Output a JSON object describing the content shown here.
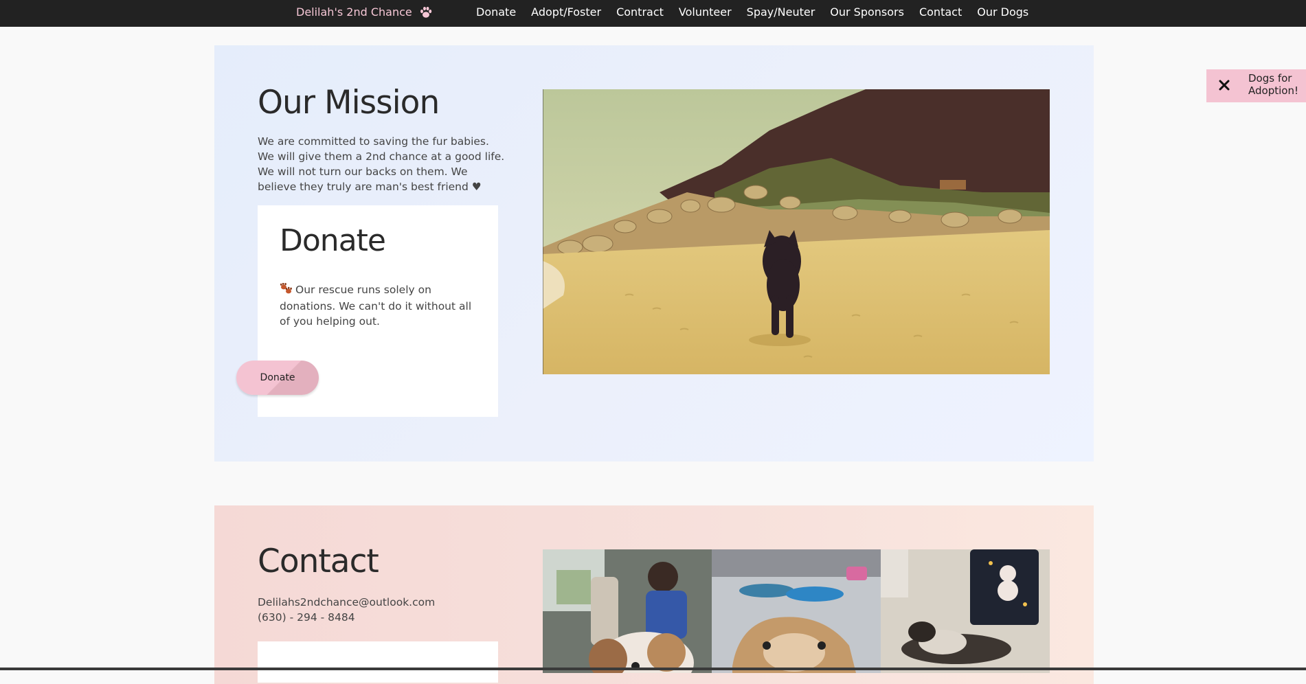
{
  "brand": {
    "name": "Delilah's 2nd Chance",
    "icon": "paw-icon"
  },
  "nav": {
    "items": [
      "Donate",
      "Adopt/Foster",
      "Contract",
      "Volunteer",
      "Spay/Neuter",
      "Our Sponsors",
      "Contact",
      "Our Dogs"
    ]
  },
  "mission": {
    "title": "Our Mission",
    "text": "We are committed to saving the fur babies. We will give them a 2nd chance at a good life. We will not turn our backs on them. We believe they truly are man's best friend ♥"
  },
  "donate": {
    "title": "Donate",
    "text": "Our rescue runs solely on donations. We can't do it without all of you helping out.",
    "button_label": "Donate"
  },
  "contact": {
    "title": "Contact",
    "email": "Delilahs2ndchance@outlook.com",
    "phone": "(630) - 294 - 8484"
  },
  "toast": {
    "message": "Dogs for Adoption!",
    "close_icon": "close-icon"
  },
  "colors": {
    "topbar": "#222222",
    "brand": "#f6c7d6",
    "pink_accent": "#f4c3d2",
    "mission_bg": "#e9eefb",
    "contact_bg": "#f6dcd8"
  }
}
